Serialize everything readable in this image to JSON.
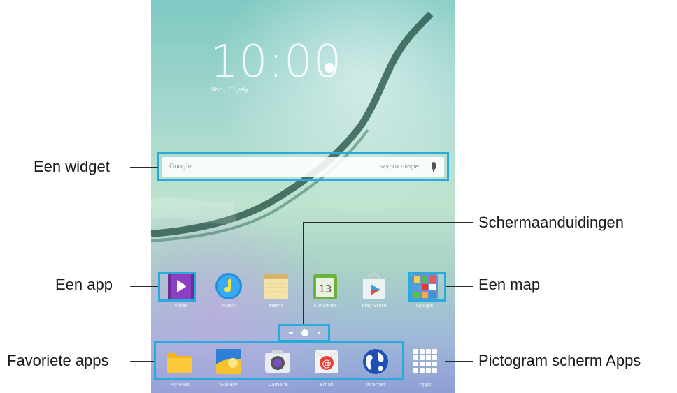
{
  "home_screen": {
    "clock": "10:00",
    "date": "Mon, 13 July",
    "weather_temp": "",
    "search": {
      "brand": "Google",
      "hint": "Say \"Ok Google\""
    },
    "apps": [
      {
        "name": "Video",
        "icon": "video-play-icon"
      },
      {
        "name": "Music",
        "icon": "music-note-icon"
      },
      {
        "name": "Memo",
        "icon": "memo-notepad-icon"
      },
      {
        "name": "S Planner",
        "icon": "calendar-icon"
      },
      {
        "name": "Play Store",
        "icon": "play-store-icon"
      },
      {
        "name": "Google",
        "icon": "google-folder-icon"
      }
    ],
    "dock": [
      {
        "name": "My Files",
        "icon": "folder-icon"
      },
      {
        "name": "Gallery",
        "icon": "gallery-icon"
      },
      {
        "name": "Camera",
        "icon": "camera-icon"
      },
      {
        "name": "Email",
        "icon": "email-icon"
      },
      {
        "name": "Internet",
        "icon": "globe-icon"
      },
      {
        "name": "Apps",
        "icon": "apps-grid-icon"
      }
    ]
  },
  "callouts": {
    "widget": "Een widget",
    "app": "Een app",
    "favorites": "Favoriete apps",
    "indicators": "Schermaanduidingen",
    "folder": "Een map",
    "apps_screen_icon": "Pictogram scherm Apps"
  },
  "colors": {
    "highlight": "#29aadc",
    "leader_line": "#2a2a2a"
  }
}
